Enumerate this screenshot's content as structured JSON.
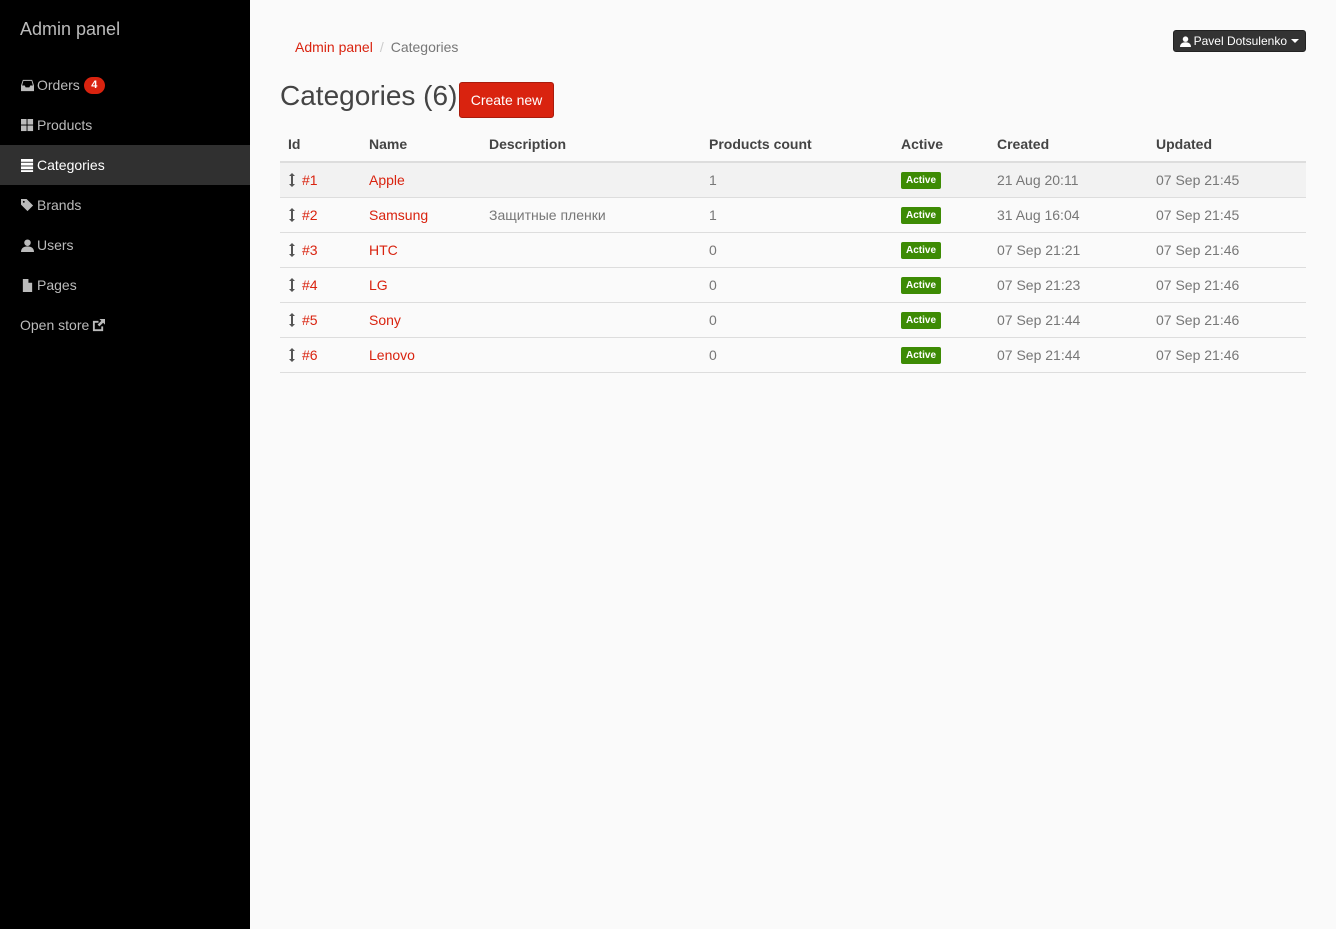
{
  "sidebar": {
    "brand": "Admin panel",
    "items": [
      {
        "label": "Orders",
        "icon": "inbox-icon",
        "badge": "4"
      },
      {
        "label": "Products",
        "icon": "grid-icon"
      },
      {
        "label": "Categories",
        "icon": "list-icon",
        "active": true
      },
      {
        "label": "Brands",
        "icon": "tags-icon"
      },
      {
        "label": "Users",
        "icon": "user-icon"
      },
      {
        "label": "Pages",
        "icon": "file-icon"
      },
      {
        "label": "Open store",
        "icon": "external-link-icon"
      }
    ]
  },
  "header": {
    "breadcrumb": [
      "Admin panel",
      "Categories"
    ],
    "user": "Pavel Dotsulenko"
  },
  "main": {
    "title": "Categories (6)",
    "create_label": "Create new",
    "columns": [
      "Id",
      "Name",
      "Description",
      "Products count",
      "Active",
      "Created",
      "Updated"
    ],
    "rows": [
      {
        "id": "#1",
        "name": "Apple",
        "description": "",
        "count": "1",
        "active": "Active",
        "created": "21 Aug 20:11",
        "updated": "07 Sep 21:45"
      },
      {
        "id": "#2",
        "name": "Samsung",
        "description": "Защитные пленки",
        "count": "1",
        "active": "Active",
        "created": "31 Aug 16:04",
        "updated": "07 Sep 21:45"
      },
      {
        "id": "#3",
        "name": "HTC",
        "description": "",
        "count": "0",
        "active": "Active",
        "created": "07 Sep 21:21",
        "updated": "07 Sep 21:46"
      },
      {
        "id": "#4",
        "name": "LG",
        "description": "",
        "count": "0",
        "active": "Active",
        "created": "07 Sep 21:23",
        "updated": "07 Sep 21:46"
      },
      {
        "id": "#5",
        "name": "Sony",
        "description": "",
        "count": "0",
        "active": "Active",
        "created": "07 Sep 21:44",
        "updated": "07 Sep 21:46"
      },
      {
        "id": "#6",
        "name": "Lenovo",
        "description": "",
        "count": "0",
        "active": "Active",
        "created": "07 Sep 21:44",
        "updated": "07 Sep 21:46"
      }
    ]
  },
  "colors": {
    "accent": "#d9230f",
    "success": "#3d8b04",
    "sidebar": "#000000"
  }
}
